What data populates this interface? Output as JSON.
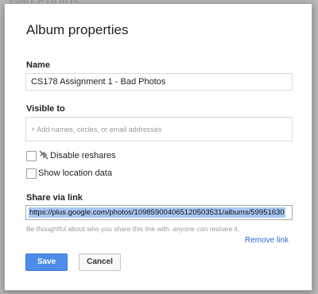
{
  "backdrop": {
    "text": "Bad Photos"
  },
  "dialog": {
    "title": "Album properties",
    "name": {
      "label": "Name",
      "value": "CS178 Assignment 1 - Bad Photos"
    },
    "visible_to": {
      "label": "Visible to",
      "placeholder": "+ Add names, circles, or email addresses"
    },
    "options": {
      "disable_reshares": {
        "label": "Disable reshares",
        "icon": "no-reshare-icon",
        "checked": false
      },
      "show_location": {
        "label": "Show location data",
        "checked": false
      }
    },
    "share": {
      "label": "Share via link",
      "url": "https://plus.google.com/photos/109859004065120503531/albums/59951630",
      "hint": "Be thoughtful about who you share this link with: anyone can reshare it.",
      "remove_link": "Remove link"
    },
    "buttons": {
      "save": "Save",
      "cancel": "Cancel"
    },
    "colors": {
      "primary": "#4d8de9",
      "link": "#3366cc",
      "selection": "#a6c8f2"
    }
  }
}
